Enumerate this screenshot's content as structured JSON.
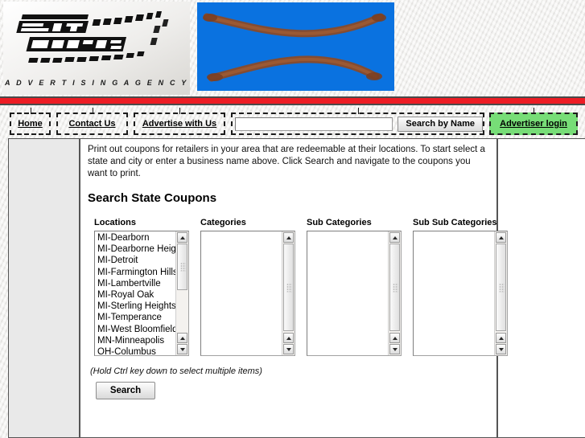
{
  "site": {
    "logo_title": "STATE COUPONS",
    "logo_tagline": "A D V E R T I S I N G   A G E N C Y",
    "accent_red": "#ed1c24",
    "banner_blue": "#0a72e0",
    "login_green": "#77dd77"
  },
  "nav": {
    "home": "Home",
    "contact": "Contact Us",
    "advertise": "Advertise with Us",
    "search_value": "",
    "search_placeholder": "",
    "search_button": "Search by Name",
    "login": "Advertiser login"
  },
  "main": {
    "intro": "Print out coupons for retailers in your area that are redeemable at their locations.  To start select a state and city or enter a business name above.  Click Search and navigate to the coupons you want to print.",
    "heading": "Search State Coupons",
    "hint": "(Hold Ctrl key down to select multiple items)",
    "search_button": "Search"
  },
  "lists": [
    {
      "label": "Locations",
      "options": [
        "MI-Dearborn",
        "MI-Dearborne Heights",
        "MI-Detroit",
        "MI-Farmington Hills",
        "MI-Lambertville",
        "MI-Royal Oak",
        "MI-Sterling Heights",
        "MI-Temperance",
        "MI-West Bloomfield",
        "MN-Minneapolis",
        "OH-Columbus"
      ]
    },
    {
      "label": "Categories",
      "options": []
    },
    {
      "label": "Sub Categories",
      "options": []
    },
    {
      "label": "Sub Sub Categories",
      "options": []
    }
  ]
}
